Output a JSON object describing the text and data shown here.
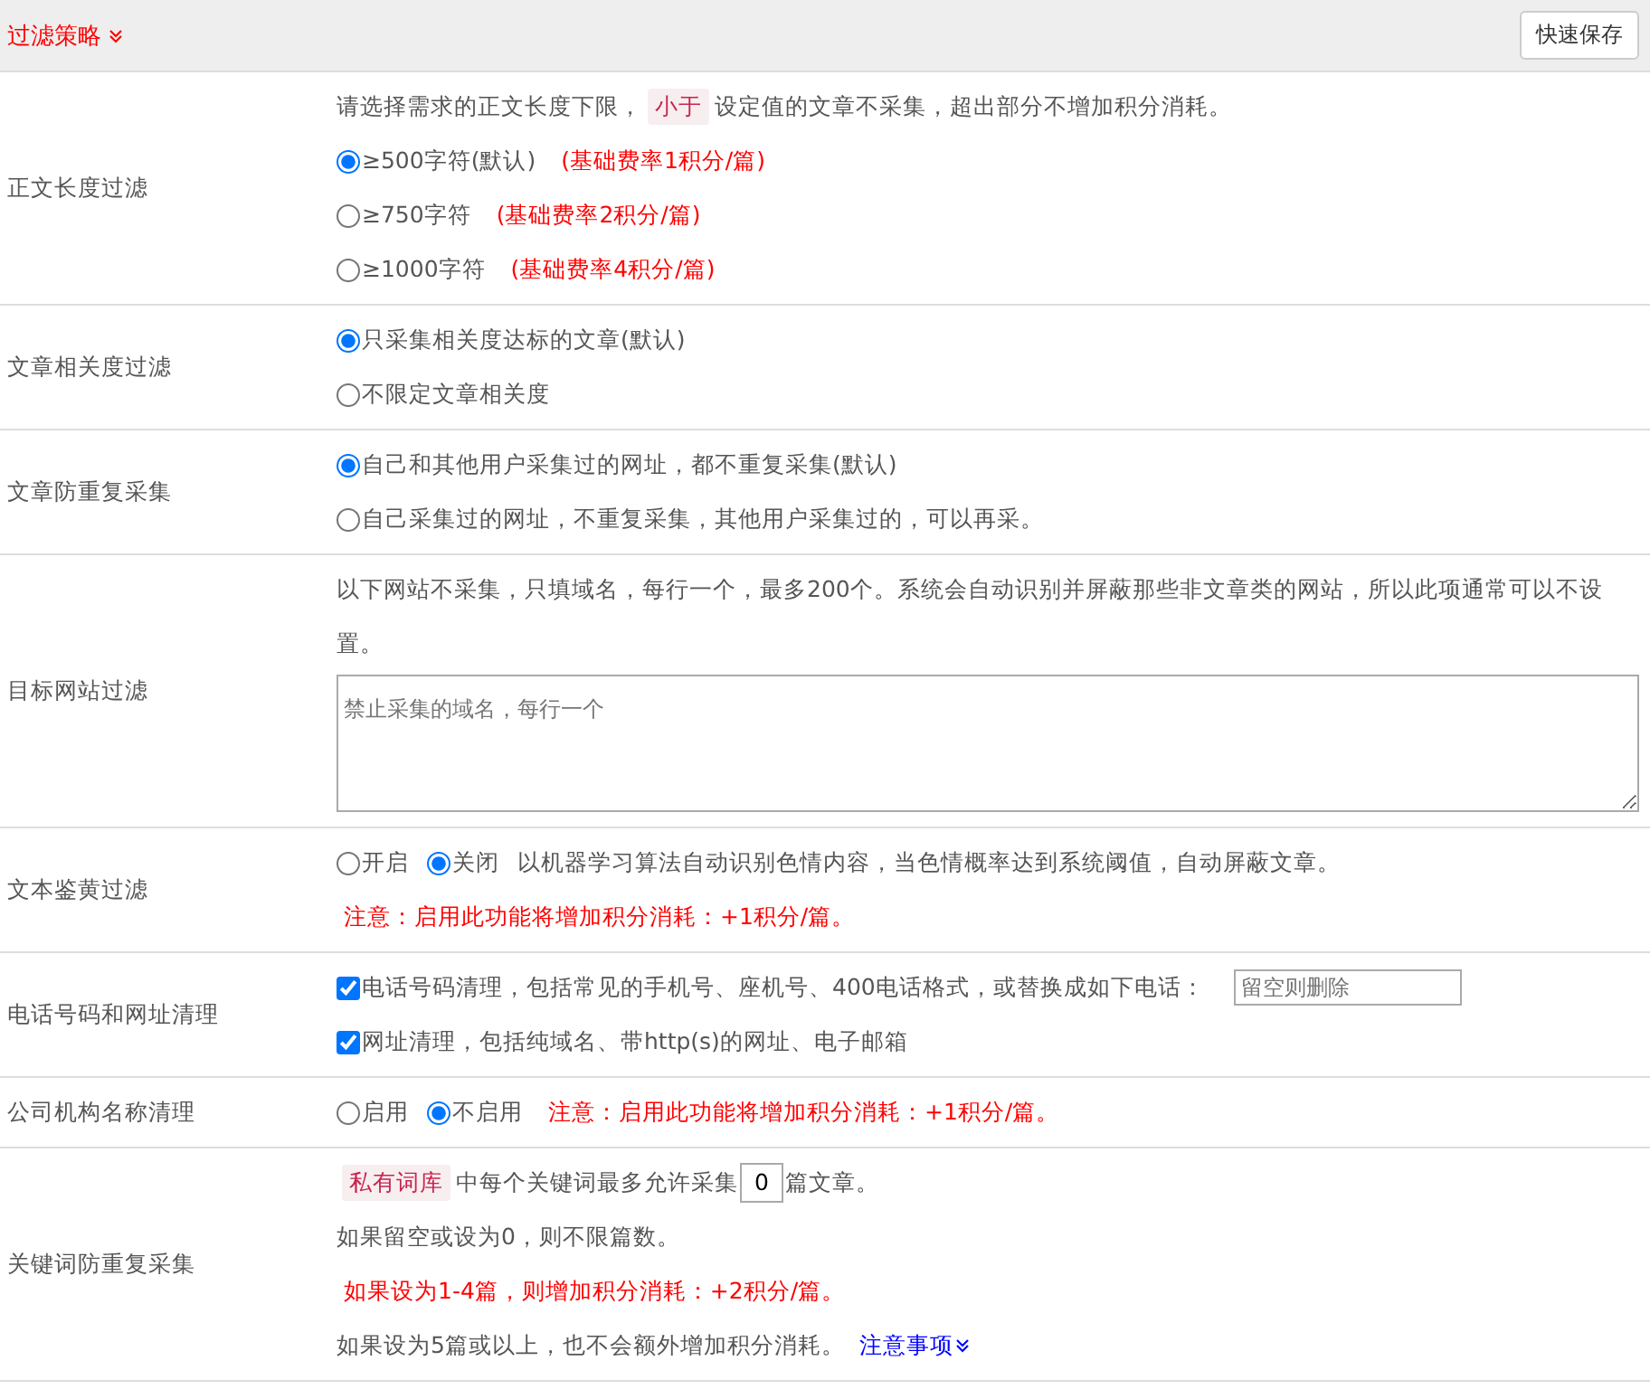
{
  "header": {
    "title": "过滤策略",
    "button": "快速保存"
  },
  "sections": [
    {
      "label": "正文长度过滤",
      "lines": [
        {
          "parts": [
            {
              "kind": "text",
              "text": "请选择需求的正文长度下限，"
            },
            {
              "kind": "tag",
              "text": "小于"
            },
            {
              "kind": "text",
              "text": "设定值的文章不采集，超出部分不增加积分消耗。"
            }
          ]
        },
        {
          "parts": [
            {
              "kind": "radio",
              "label": "≥500字符(默认)",
              "selected": true
            },
            {
              "kind": "red",
              "text": "(基础费率1积分/篇)"
            }
          ]
        },
        {
          "parts": [
            {
              "kind": "radio",
              "label": "≥750字符",
              "selected": false
            },
            {
              "kind": "red",
              "text": "(基础费率2积分/篇)"
            }
          ]
        },
        {
          "parts": [
            {
              "kind": "radio",
              "label": "≥1000字符",
              "selected": false
            },
            {
              "kind": "red",
              "text": "(基础费率4积分/篇)"
            }
          ]
        }
      ]
    },
    {
      "label": "文章相关度过滤",
      "lines": [
        {
          "parts": [
            {
              "kind": "radio",
              "label": "只采集相关度达标的文章(默认)",
              "selected": true
            }
          ]
        },
        {
          "parts": [
            {
              "kind": "radio",
              "label": "不限定文章相关度",
              "selected": false
            }
          ]
        }
      ]
    },
    {
      "label": "文章防重复采集",
      "lines": [
        {
          "parts": [
            {
              "kind": "radio",
              "label": "自己和其他用户采集过的网址，都不重复采集(默认)",
              "selected": true
            }
          ]
        },
        {
          "parts": [
            {
              "kind": "radio",
              "label": "自己采集过的网址，不重复采集，其他用户采集过的，可以再采。",
              "selected": false
            }
          ]
        }
      ]
    },
    {
      "label": "目标网站过滤",
      "lines": [
        {
          "parts": [
            {
              "kind": "text",
              "text": "以下网站不采集，只填域名，每行一个，最多200个。系统会自动识别并屏蔽那些非文章类的网站，所以此项通常可以不设置。"
            }
          ]
        },
        {
          "parts": [
            {
              "kind": "textarea",
              "placeholder": "禁止采集的域名，每行一个"
            }
          ]
        }
      ]
    },
    {
      "label": "文本鉴黄过滤",
      "lines": [
        {
          "parts": [
            {
              "kind": "radio",
              "label": "开启",
              "selected": false
            },
            {
              "kind": "radio",
              "label": "关闭",
              "selected": true
            },
            {
              "kind": "text",
              "text": "以机器学习算法自动识别色情内容，当色情概率达到系统阈值，自动屏蔽文章。"
            }
          ]
        },
        {
          "parts": [
            {
              "kind": "red",
              "text": "注意：启用此功能将增加积分消耗：+1积分/篇。"
            }
          ]
        }
      ]
    },
    {
      "label": "电话号码和网址清理",
      "lines": [
        {
          "parts": [
            {
              "kind": "check",
              "label": "电话号码清理，包括常见的手机号、座机号、400电话格式，或替换成如下电话：",
              "checked": true
            },
            {
              "kind": "input",
              "placeholder": "留空则删除"
            }
          ]
        },
        {
          "parts": [
            {
              "kind": "check",
              "label": "网址清理，包括纯域名、带http(s)的网址、电子邮箱",
              "checked": true
            }
          ]
        }
      ]
    },
    {
      "label": "公司机构名称清理",
      "lines": [
        {
          "parts": [
            {
              "kind": "radio",
              "label": "启用",
              "selected": false
            },
            {
              "kind": "radio",
              "label": "不启用",
              "selected": true
            },
            {
              "kind": "red",
              "text": "注意：启用此功能将增加积分消耗：+1积分/篇。"
            }
          ]
        }
      ]
    },
    {
      "label": "关键词防重复采集",
      "lines": [
        {
          "parts": [
            {
              "kind": "tag",
              "text": "私有词库"
            },
            {
              "kind": "text",
              "text": "中每个关键词最多允许采集"
            },
            {
              "kind": "number",
              "value": "0"
            },
            {
              "kind": "text",
              "text": "篇文章。"
            }
          ]
        },
        {
          "parts": [
            {
              "kind": "text",
              "text": "如果留空或设为0，则不限篇数。"
            }
          ]
        },
        {
          "parts": [
            {
              "kind": "red",
              "text": "如果设为1-4篇，则增加积分消耗：+2积分/篇。"
            }
          ]
        },
        {
          "parts": [
            {
              "kind": "text",
              "text": "如果设为5篇或以上，也不会额外增加积分消耗。"
            },
            {
              "kind": "link",
              "text": "注意事项"
            }
          ]
        }
      ]
    }
  ]
}
